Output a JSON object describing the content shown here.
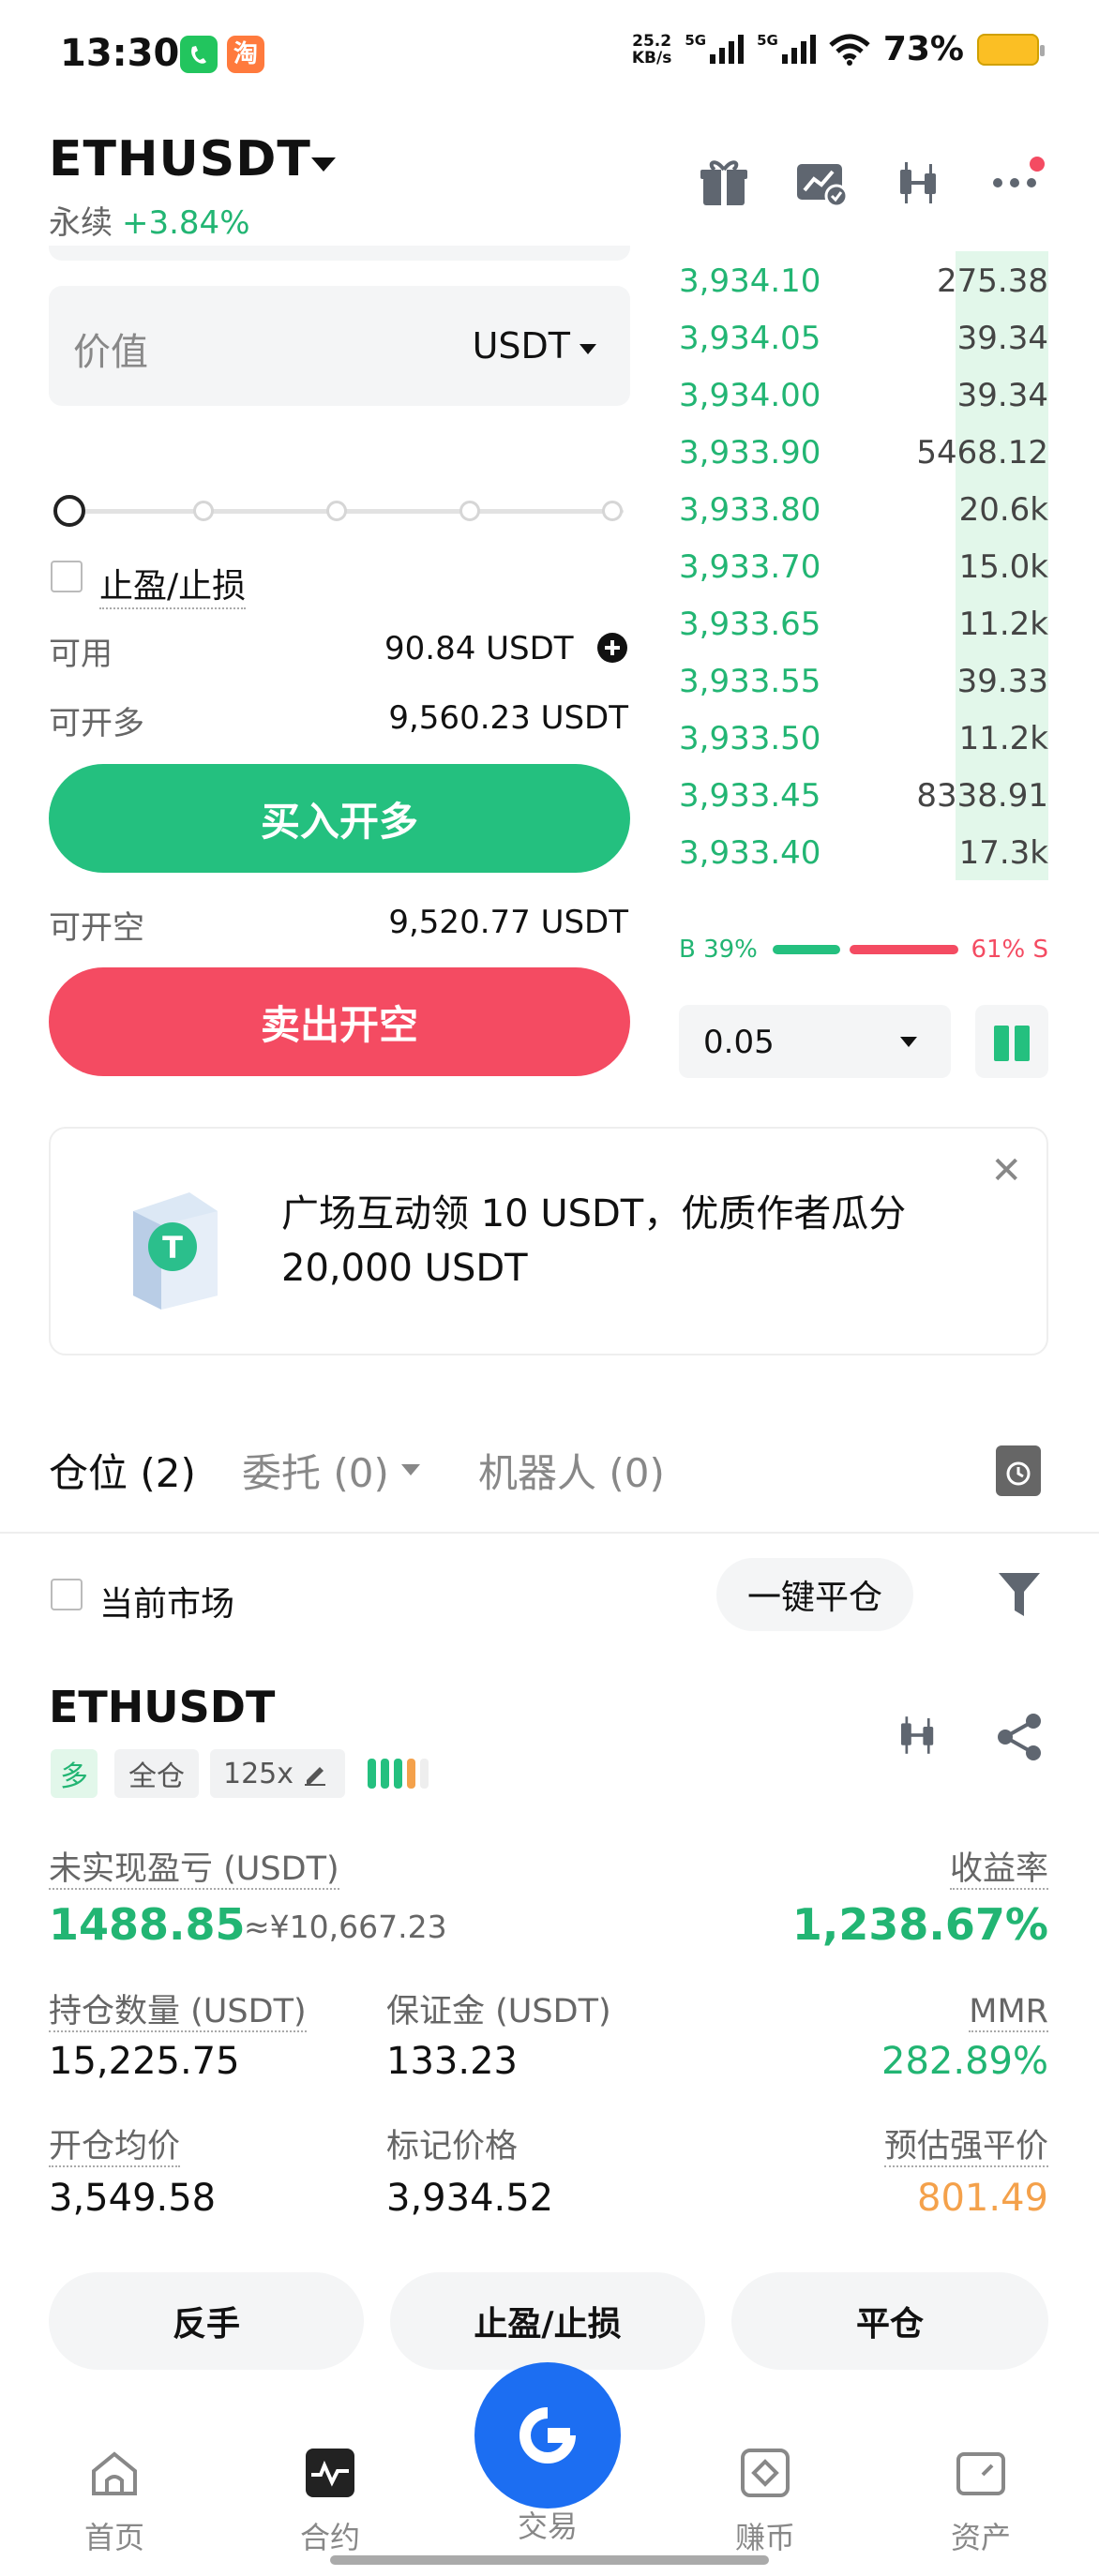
{
  "status_bar": {
    "time": "13:30",
    "net_speed_value": "25.2",
    "net_speed_unit": "KB/s",
    "signal_1": "5G",
    "signal_2": "5G",
    "battery": "73%",
    "icons": [
      "wechat-icon",
      "taobao-icon",
      "wifi-icon",
      "battery-icon"
    ]
  },
  "header": {
    "pair": "ETHUSDT",
    "type": "永续",
    "change": "+3.84%",
    "icons": [
      "gift-icon",
      "chart-settings-icon",
      "candlestick-icon",
      "more-icon"
    ],
    "colors": {
      "up": "#22b573",
      "down": "#f44b62",
      "notification": "#f44b62"
    }
  },
  "order_form": {
    "value_label": "价值",
    "unit": "USDT",
    "slider_level": 0,
    "tpsl_label": "止盈/止损",
    "available_label": "可用",
    "available_value": "90.84  USDT",
    "open_long_label": "可开多",
    "open_long_value": "9,560.23 USDT",
    "buy_button": "买入开多",
    "open_short_label": "可开空",
    "open_short_value": "9,520.77 USDT",
    "sell_button": "卖出开空"
  },
  "order_book": {
    "rows": [
      {
        "price": "3,934.10",
        "qty": "275.38",
        "depth": 0.25
      },
      {
        "price": "3,934.05",
        "qty": "39.34",
        "depth": 0.25
      },
      {
        "price": "3,934.00",
        "qty": "39.34",
        "depth": 0.25
      },
      {
        "price": "3,933.90",
        "qty": "5468.12",
        "depth": 0.25
      },
      {
        "price": "3,933.80",
        "qty": "20.6k",
        "depth": 0.25
      },
      {
        "price": "3,933.70",
        "qty": "15.0k",
        "depth": 0.25
      },
      {
        "price": "3,933.65",
        "qty": "11.2k",
        "depth": 0.25
      },
      {
        "price": "3,933.55",
        "qty": "39.33",
        "depth": 0.25
      },
      {
        "price": "3,933.50",
        "qty": "11.2k",
        "depth": 0.25
      },
      {
        "price": "3,933.45",
        "qty": "8338.91",
        "depth": 0.25
      },
      {
        "price": "3,933.40",
        "qty": "17.3k",
        "depth": 0.25
      }
    ],
    "buy_ratio_label": "B 39%",
    "sell_ratio_label": "61% S",
    "buy_ratio": 0.39,
    "precision": "0.05"
  },
  "banner": {
    "text": "广场互动领 10 USDT，优质作者瓜分 20,000 USDT"
  },
  "tabs": {
    "positions": "仓位 (2)",
    "orders": "委托 (0)",
    "bots": "机器人 (0)"
  },
  "filters": {
    "current_market": "当前市场",
    "close_all": "一键平仓"
  },
  "position": {
    "symbol": "ETHUSDT",
    "side": "多",
    "margin_mode": "全仓",
    "leverage": "125x",
    "unrealized_pnl_label": "未实现盈亏 (USDT)",
    "unrealized_pnl": "1488.85",
    "unrealized_pnl_cny": "≈¥10,667.23",
    "roe_label": "收益率",
    "roe": "1,238.67%",
    "size_label": "持仓数量 (USDT)",
    "size": "15,225.75",
    "margin_label": "保证金 (USDT)",
    "margin": "133.23",
    "mmr_label": "MMR",
    "mmr": "282.89%",
    "entry_label": "开仓均价",
    "entry": "3,549.58",
    "mark_label": "标记价格",
    "mark": "3,934.52",
    "liq_label": "预估强平价",
    "liq": "801.49",
    "reverse_button": "反手",
    "tpsl_button": "止盈/止损",
    "close_button": "平仓"
  },
  "bottom_nav": {
    "home": "首页",
    "futures": "合约",
    "trade": "交易",
    "earn": "赚币",
    "assets": "资产"
  }
}
